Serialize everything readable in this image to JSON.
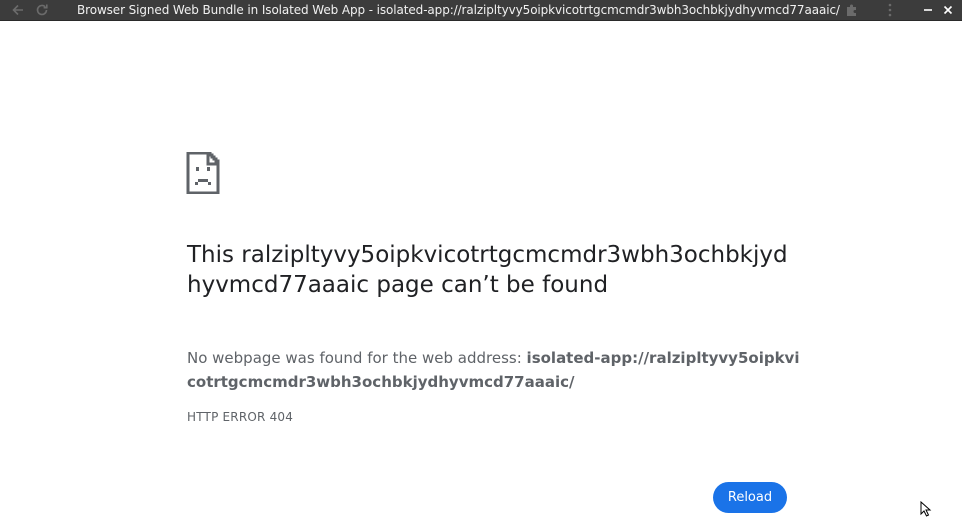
{
  "window": {
    "title": "Browser Signed Web Bundle in Isolated Web App - isolated-app://ralzipltyvy5oipkvicotrtgcmcmdr3wbh3ochbkjydhyvmcd77aaaic/",
    "icons": {
      "back": "back-arrow-icon",
      "reload": "reload-icon",
      "extensions": "puzzle-piece-icon",
      "menu": "kebab-menu-icon",
      "minimize": "minimize-icon",
      "close": "close-icon"
    },
    "bar_color": "#3c3c3c"
  },
  "error_page": {
    "icon": "sad-page-icon",
    "heading": "This ralzipltyvy5oipkvicotrtgcmcmdr3wbh3ochbkjydhyvmcd77aaaic page can’t be found",
    "description_prefix": "No webpage was found for the web address: ",
    "description_url": "isolated-app://ralzipltyvy5oipkvicotrtgcmcmdr3wbh3ochbkjydhyvmcd77aaaic/",
    "error_code": "HTTP ERROR 404",
    "reload_label": "Reload",
    "accent_color": "#1a73e8"
  }
}
